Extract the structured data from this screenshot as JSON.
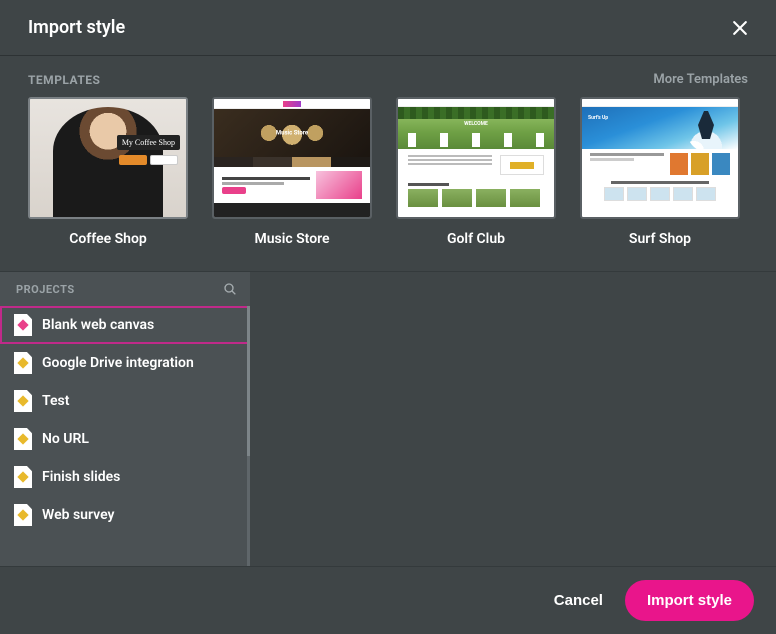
{
  "modal": {
    "title": "Import style",
    "templates_label": "TEMPLATES",
    "more_templates": "More Templates",
    "projects_label": "PROJECTS"
  },
  "templates": [
    {
      "name": "Coffee Shop"
    },
    {
      "name": "Music Store"
    },
    {
      "name": "Golf Club"
    },
    {
      "name": "Surf Shop"
    }
  ],
  "projects": [
    {
      "label": "Blank web canvas",
      "icon": "pink",
      "selected": true
    },
    {
      "label": "Google Drive integration",
      "icon": "yellow",
      "selected": false
    },
    {
      "label": "Test",
      "icon": "yellow",
      "selected": false
    },
    {
      "label": "No URL",
      "icon": "yellow",
      "selected": false
    },
    {
      "label": "Finish slides",
      "icon": "yellow",
      "selected": false
    },
    {
      "label": "Web survey",
      "icon": "yellow",
      "selected": false
    }
  ],
  "footer": {
    "cancel": "Cancel",
    "confirm": "Import style"
  },
  "thumb_text": {
    "coffee_badge": "My Coffee Shop",
    "music_hero": "Music Store",
    "surf_hero": "Surf's Up"
  }
}
